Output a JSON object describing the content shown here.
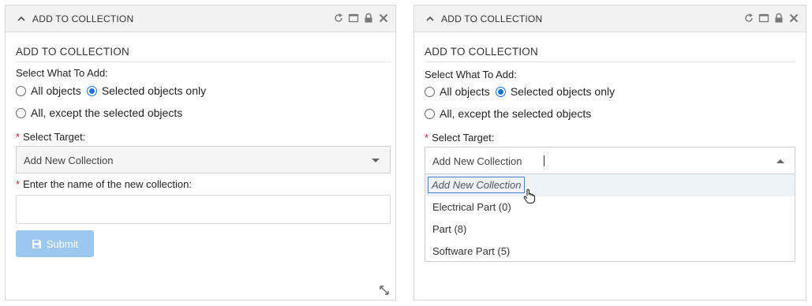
{
  "left_panel": {
    "header_title": "ADD TO COLLECTION",
    "section_title": "ADD TO COLLECTION",
    "select_what_label": "Select What To Add:",
    "radio_all": "All objects",
    "radio_selected": "Selected objects only",
    "radio_except": "All, except the selected objects",
    "selected_radio": "Selected objects only",
    "select_target_label": "Select Target:",
    "target_value": "Add New Collection",
    "name_label": "Enter the name of the new collection:",
    "name_value": "",
    "submit_label": "Submit"
  },
  "right_panel": {
    "header_title": "ADD TO COLLECTION",
    "section_title": "ADD TO COLLECTION",
    "select_what_label": "Select What To Add:",
    "radio_all": "All objects",
    "radio_selected": "Selected objects only",
    "radio_except": "All, except the selected objects",
    "selected_radio": "Selected objects only",
    "select_target_label": "Select Target:",
    "target_value": "Add New Collection",
    "dropdown_options": [
      "Add New Collection",
      "Electrical Part (0)",
      "Part (8)",
      "Software Part (5)"
    ],
    "highlighted_option": "Add New Collection"
  },
  "icons": {
    "header_collapse": "chevron-up-icon",
    "header_actions": [
      "refresh-icon",
      "maximize-icon",
      "lock-icon",
      "close-icon"
    ],
    "submit": "save-icon",
    "resize": "resize-icon",
    "pointer": "hand-pointer-icon"
  },
  "colors": {
    "required_star": "#d9232e",
    "radio_selected": "#1d6fd8",
    "submit_bg_disabled": "#9cc8ef",
    "header_bg": "#f2f2f2"
  }
}
